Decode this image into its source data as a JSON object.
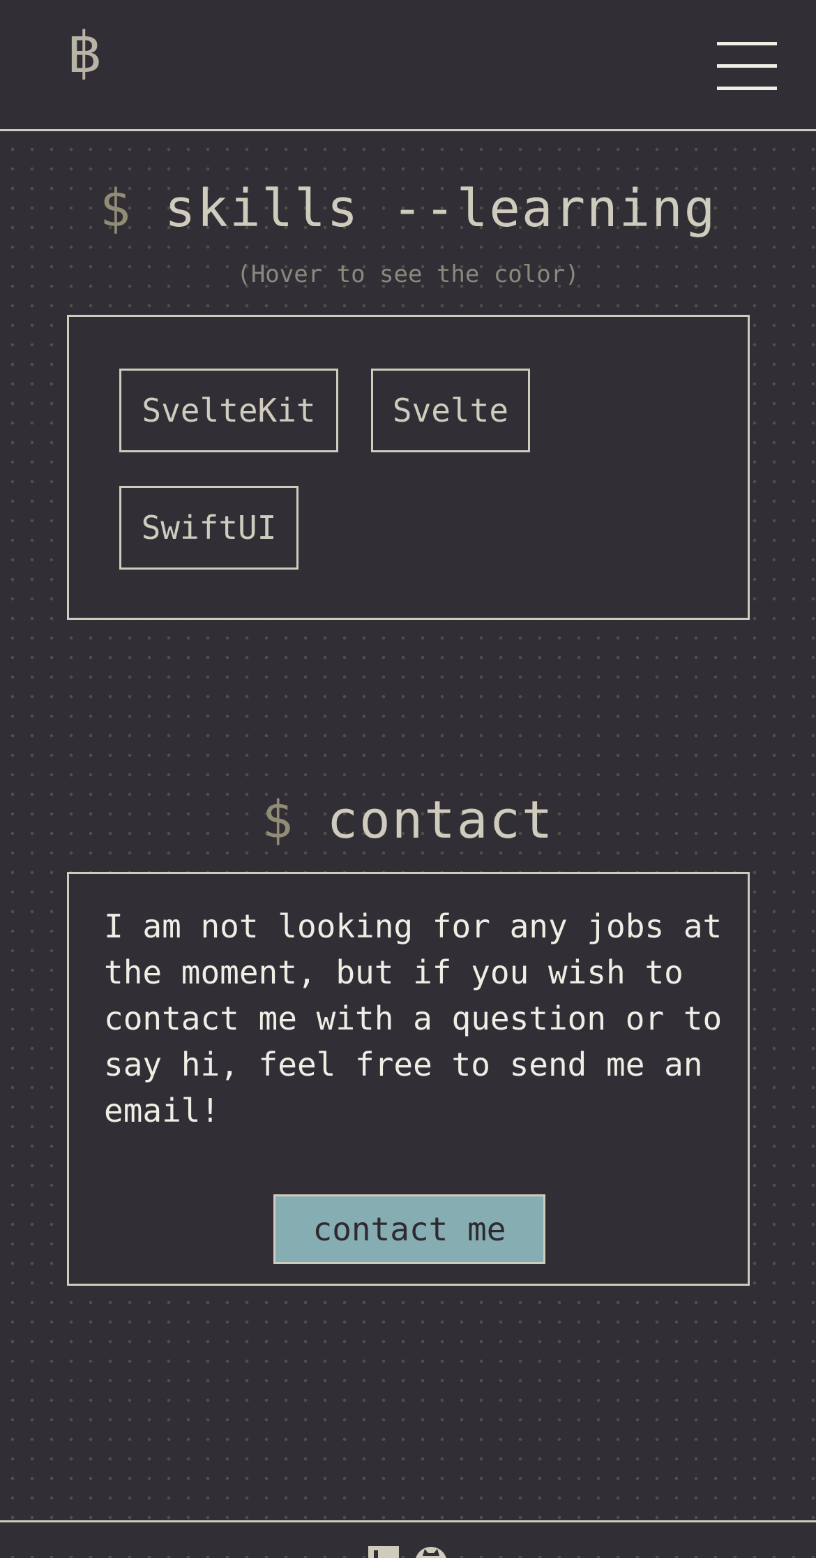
{
  "header": {
    "logo": "฿",
    "menu_icon": "hamburger-menu-icon"
  },
  "skills": {
    "prompt": "$",
    "title": "skills --learning",
    "hint": "(Hover to see the color)",
    "items": [
      {
        "label": "SvelteKit"
      },
      {
        "label": "Svelte"
      },
      {
        "label": "SwiftUI"
      }
    ]
  },
  "contact": {
    "prompt": "$",
    "title": "contact",
    "text": "I am not looking for any jobs at the moment, but if you wish to contact me with a question or to say hi, feel free to send me an email!",
    "button_label": "contact me"
  },
  "footer": {
    "icons": [
      "linkedin-icon",
      "github-icon"
    ]
  },
  "colors": {
    "background": "#322e36",
    "foreground": "#cfcbbd",
    "prompt": "#908c76",
    "accent": "#86aeb2"
  }
}
